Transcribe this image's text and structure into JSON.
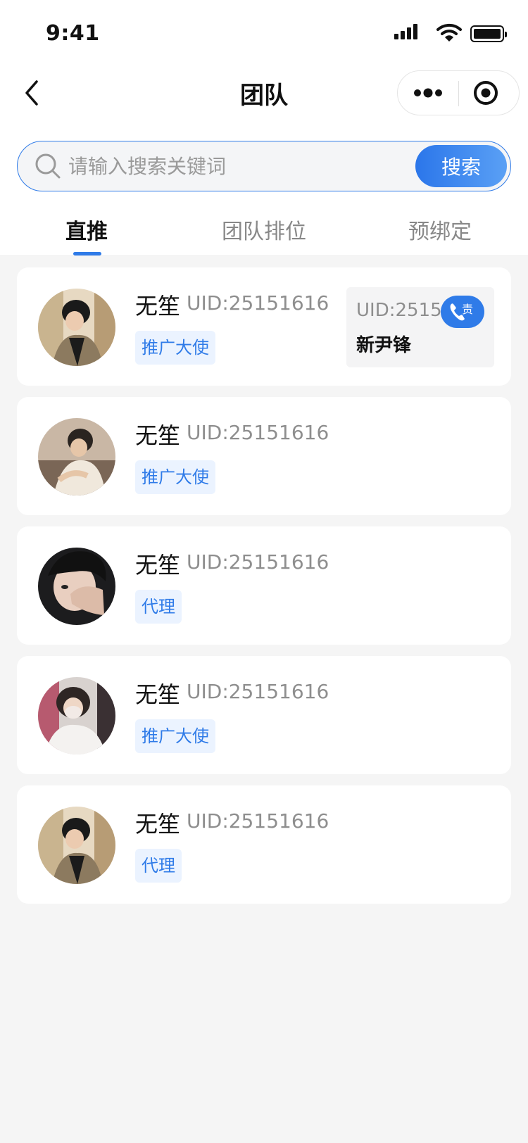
{
  "status_bar": {
    "time": "9:41"
  },
  "nav": {
    "title": "团队"
  },
  "search": {
    "placeholder": "请输入搜索关键词",
    "button_label": "搜索"
  },
  "tabs": [
    {
      "label": "直推",
      "active": true
    },
    {
      "label": "团队排位",
      "active": false
    },
    {
      "label": "预绑定",
      "active": false
    }
  ],
  "members": [
    {
      "name": "无笙",
      "uid": "UID:25151616",
      "role": "推广大使",
      "referrer": {
        "uid": "UID:2515",
        "name": "新尹锋",
        "call_mark": "责"
      }
    },
    {
      "name": "无笙",
      "uid": "UID:25151616",
      "role": "推广大使"
    },
    {
      "name": "无笙",
      "uid": "UID:25151616",
      "role": "代理"
    },
    {
      "name": "无笙",
      "uid": "UID:25151616",
      "role": "推广大使"
    },
    {
      "name": "无笙",
      "uid": "UID:25151616",
      "role": "代理"
    }
  ],
  "colors": {
    "accent": "#2f7be8",
    "badge_bg": "#ebf3ff",
    "page_bg": "#f5f5f5"
  }
}
